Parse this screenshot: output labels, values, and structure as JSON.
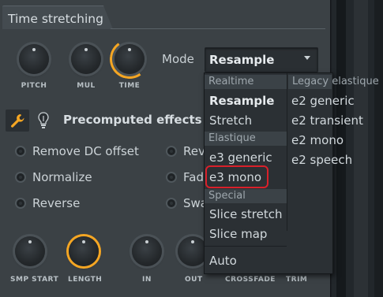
{
  "section": {
    "title": "Time stretching"
  },
  "knobs_top": [
    {
      "label": "PITCH"
    },
    {
      "label": "MUL"
    },
    {
      "label": "TIME"
    }
  ],
  "mode": {
    "label": "Mode",
    "value": "Resample"
  },
  "precomputed": {
    "label": "Precomputed effects"
  },
  "options_left": [
    {
      "label": "Remove DC offset"
    },
    {
      "label": "Normalize"
    },
    {
      "label": "Reverse"
    }
  ],
  "options_right": [
    {
      "label": "Rev"
    },
    {
      "label": "Fad"
    },
    {
      "label": "Swa"
    }
  ],
  "knobs_bottom": [
    {
      "label": "SMP START"
    },
    {
      "label": "LENGTH"
    },
    {
      "label": "IN"
    },
    {
      "label": "OUT"
    },
    {
      "label": "CROSSFADE"
    },
    {
      "label": "TRIM"
    }
  ],
  "dropdown": {
    "groups": {
      "realtime": "Realtime",
      "elastique": "Elastique",
      "special": "Special",
      "legacy": "Legacy elastique"
    },
    "realtime_items": [
      "Resample",
      "Stretch"
    ],
    "elastique_items": [
      "e3 generic",
      "e3 mono"
    ],
    "special_items": [
      "Slice stretch",
      "Slice map"
    ],
    "auto_item": "Auto",
    "legacy_items": [
      "e2 generic",
      "e2 transient",
      "e2 mono",
      "e2 speech"
    ]
  },
  "colors": {
    "accent": "#f5a623",
    "highlight": "#d9202a",
    "panel": "#3b4145"
  }
}
